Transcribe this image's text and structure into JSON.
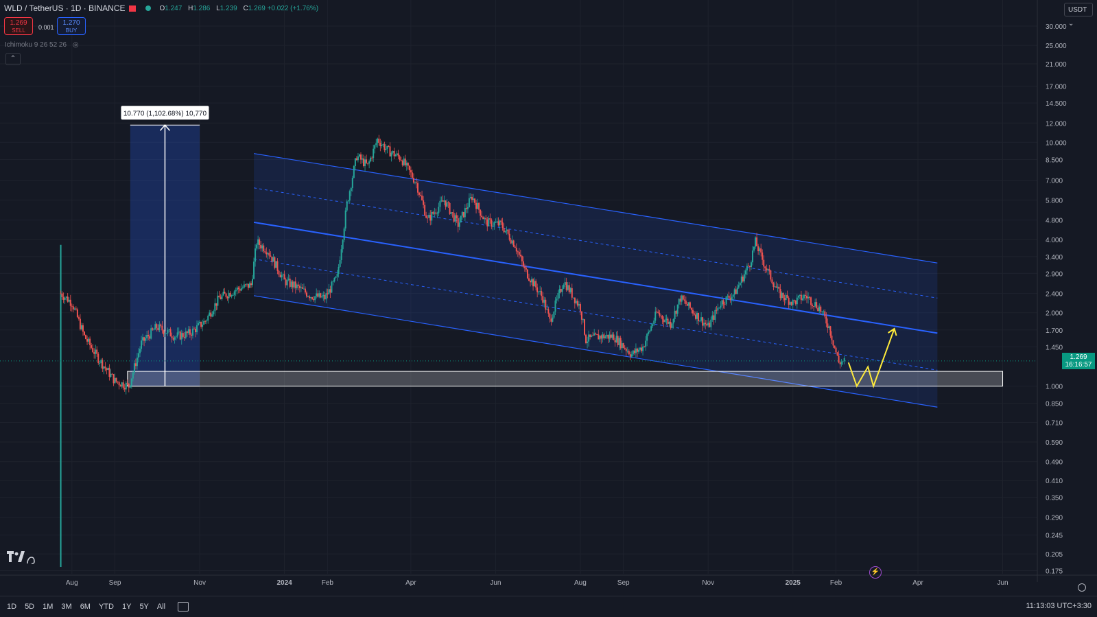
{
  "header": {
    "symbol": "WLD / TetherUS · 1D · BINANCE",
    "ohlc": {
      "open_label": "O",
      "open": "1.247",
      "high_label": "H",
      "high": "1.286",
      "low_label": "L",
      "low": "1.239",
      "close_label": "C",
      "close": "1.269 +0.022 (+1.76%)"
    }
  },
  "trade": {
    "sell_price": "1.269",
    "sell_label": "SELL",
    "spread": "0.001",
    "buy_price": "1.270",
    "buy_label": "BUY"
  },
  "indicator": {
    "label": "Ichimoku 9 26 52 26"
  },
  "currency": "USDT",
  "current_price": {
    "price": "1.269",
    "countdown": "16:16:57"
  },
  "measure_label": "10.770 (1,102.68%) 10,770",
  "price_axis": [
    "30.000",
    "25.000",
    "21.000",
    "17.000",
    "14.500",
    "12.000",
    "10.000",
    "8.500",
    "7.000",
    "5.800",
    "4.800",
    "4.000",
    "3.400",
    "2.900",
    "2.400",
    "2.000",
    "1.700",
    "1.450",
    "1.000",
    "0.850",
    "0.710",
    "0.590",
    "0.490",
    "0.410",
    "0.350",
    "0.290",
    "0.245",
    "0.205",
    "0.175"
  ],
  "time_axis": [
    "Aug",
    "Sep",
    "Nov",
    "2024",
    "Feb",
    "Apr",
    "Jun",
    "Aug",
    "Sep",
    "Nov",
    "2025",
    "Feb",
    "Apr",
    "Jun"
  ],
  "ranges": [
    "1D",
    "5D",
    "1M",
    "3M",
    "6M",
    "YTD",
    "1Y",
    "5Y",
    "All"
  ],
  "clock": "11:13:03 UTC+3:30",
  "colors": {
    "bg": "#151924",
    "up": "#26a69a",
    "down": "#ef5350",
    "channel": "#2962ff",
    "projection": "#ffeb3b"
  },
  "chart_data": {
    "type": "candlestick",
    "title": "",
    "xlabel": "",
    "ylabel": "",
    "scale": "log",
    "ylim": [
      0.17,
      32
    ],
    "close_series": [
      [
        "2023-07-24",
        2.4
      ],
      [
        "2023-08-01",
        2.2
      ],
      [
        "2023-08-10",
        1.6
      ],
      [
        "2023-08-20",
        1.3
      ],
      [
        "2023-09-01",
        1.05
      ],
      [
        "2023-09-11",
        1.0
      ],
      [
        "2023-09-20",
        1.5
      ],
      [
        "2023-10-01",
        1.75
      ],
      [
        "2023-10-15",
        1.6
      ],
      [
        "2023-10-25",
        1.65
      ],
      [
        "2023-11-05",
        1.85
      ],
      [
        "2023-11-15",
        2.3
      ],
      [
        "2023-11-28",
        2.5
      ],
      [
        "2023-12-08",
        2.6
      ],
      [
        "2023-12-12",
        3.9
      ],
      [
        "2023-12-20",
        3.6
      ],
      [
        "2024-01-01",
        2.7
      ],
      [
        "2024-01-10",
        2.55
      ],
      [
        "2024-01-20",
        2.35
      ],
      [
        "2024-01-30",
        2.3
      ],
      [
        "2024-02-08",
        2.8
      ],
      [
        "2024-02-15",
        5.6
      ],
      [
        "2024-02-22",
        8.8
      ],
      [
        "2024-03-01",
        8.0
      ],
      [
        "2024-03-08",
        10.3
      ],
      [
        "2024-03-15",
        9.3
      ],
      [
        "2024-03-25",
        8.6
      ],
      [
        "2024-04-05",
        6.8
      ],
      [
        "2024-04-13",
        4.8
      ],
      [
        "2024-04-25",
        5.8
      ],
      [
        "2024-05-05",
        4.6
      ],
      [
        "2024-05-15",
        6.0
      ],
      [
        "2024-05-25",
        4.7
      ],
      [
        "2024-06-05",
        4.6
      ],
      [
        "2024-06-15",
        3.8
      ],
      [
        "2024-06-22",
        3.0
      ],
      [
        "2024-07-05",
        2.3
      ],
      [
        "2024-07-10",
        1.85
      ],
      [
        "2024-07-20",
        2.7
      ],
      [
        "2024-08-01",
        2.1
      ],
      [
        "2024-08-05",
        1.55
      ],
      [
        "2024-08-15",
        1.6
      ],
      [
        "2024-08-25",
        1.6
      ],
      [
        "2024-09-07",
        1.35
      ],
      [
        "2024-09-15",
        1.45
      ],
      [
        "2024-09-25",
        2.0
      ],
      [
        "2024-10-05",
        1.8
      ],
      [
        "2024-10-12",
        2.3
      ],
      [
        "2024-10-22",
        2.0
      ],
      [
        "2024-11-01",
        1.75
      ],
      [
        "2024-11-10",
        2.2
      ],
      [
        "2024-11-20",
        2.4
      ],
      [
        "2024-12-01",
        3.2
      ],
      [
        "2024-12-05",
        3.9
      ],
      [
        "2024-12-12",
        3.1
      ],
      [
        "2024-12-22",
        2.4
      ],
      [
        "2025-01-01",
        2.2
      ],
      [
        "2025-01-10",
        2.35
      ],
      [
        "2025-01-20",
        2.1
      ],
      [
        "2025-01-27",
        1.75
      ],
      [
        "2025-02-03",
        1.25
      ],
      [
        "2025-02-08",
        1.269
      ]
    ],
    "annotations": [
      {
        "type": "price_range",
        "start": "2023-09-12",
        "end": "2023-11-01",
        "from": 1.0,
        "to": 11.77,
        "label": "10.770 (1,102.68%) 10,770"
      },
      {
        "type": "descending_channel",
        "start": "2023-12-10",
        "end": "2025-04-15",
        "upper": [
          9.0,
          3.2
        ],
        "middle": [
          4.7,
          1.65
        ],
        "lower": [
          2.35,
          0.82
        ]
      },
      {
        "type": "support_zone",
        "start": "2023-09-10",
        "end": "2025-06-01",
        "from": 1.0,
        "to": 1.15
      },
      {
        "type": "projection",
        "path": [
          [
            "2025-02-10",
            1.25
          ],
          [
            "2025-02-16",
            1.0
          ],
          [
            "2025-02-24",
            1.2
          ],
          [
            "2025-02-28",
            1.0
          ],
          [
            "2025-03-15",
            1.72
          ]
        ]
      }
    ]
  }
}
